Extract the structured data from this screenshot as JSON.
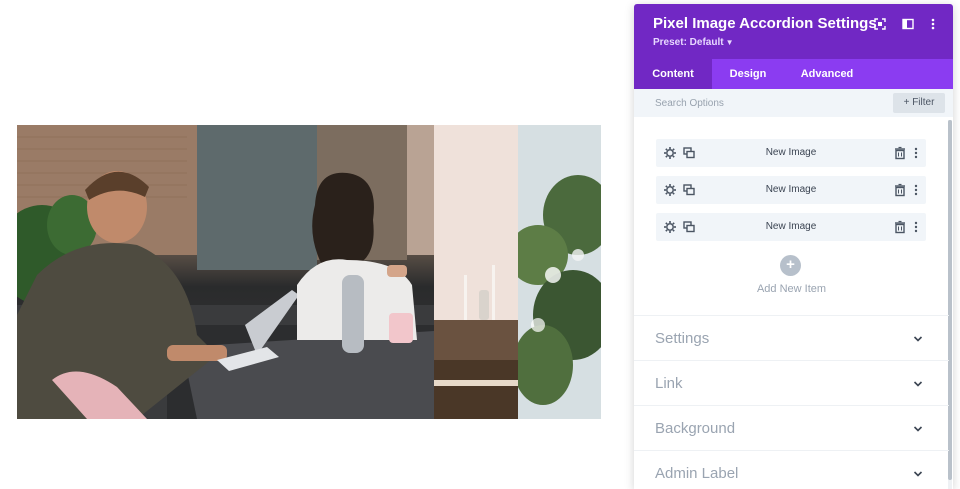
{
  "settings_panel": {
    "title": "Pixel Image Accordion Settings",
    "preset": "Preset: Default",
    "header_icons": [
      "expand-icon",
      "split-view-icon",
      "more-vertical-icon"
    ],
    "tabs": [
      {
        "label": "Content",
        "active": true
      },
      {
        "label": "Design",
        "active": false
      },
      {
        "label": "Advanced",
        "active": false
      }
    ],
    "search": {
      "placeholder": "Search Options"
    },
    "filter_label": "+ Filter",
    "items": [
      {
        "label": "New Image"
      },
      {
        "label": "New Image"
      },
      {
        "label": "New Image"
      }
    ],
    "add_item_label": "Add New Item",
    "sections": [
      {
        "title": "Settings"
      },
      {
        "title": "Link"
      },
      {
        "title": "Background"
      },
      {
        "title": "Admin Label"
      }
    ],
    "colors": {
      "header": "#7128c4",
      "tabs": "#8b3cf1",
      "item_bg": "#f1f5f9"
    }
  },
  "accordion_preview": {
    "panels": [
      "photo-office-team",
      "photo-table-candles",
      "photo-plants"
    ]
  }
}
